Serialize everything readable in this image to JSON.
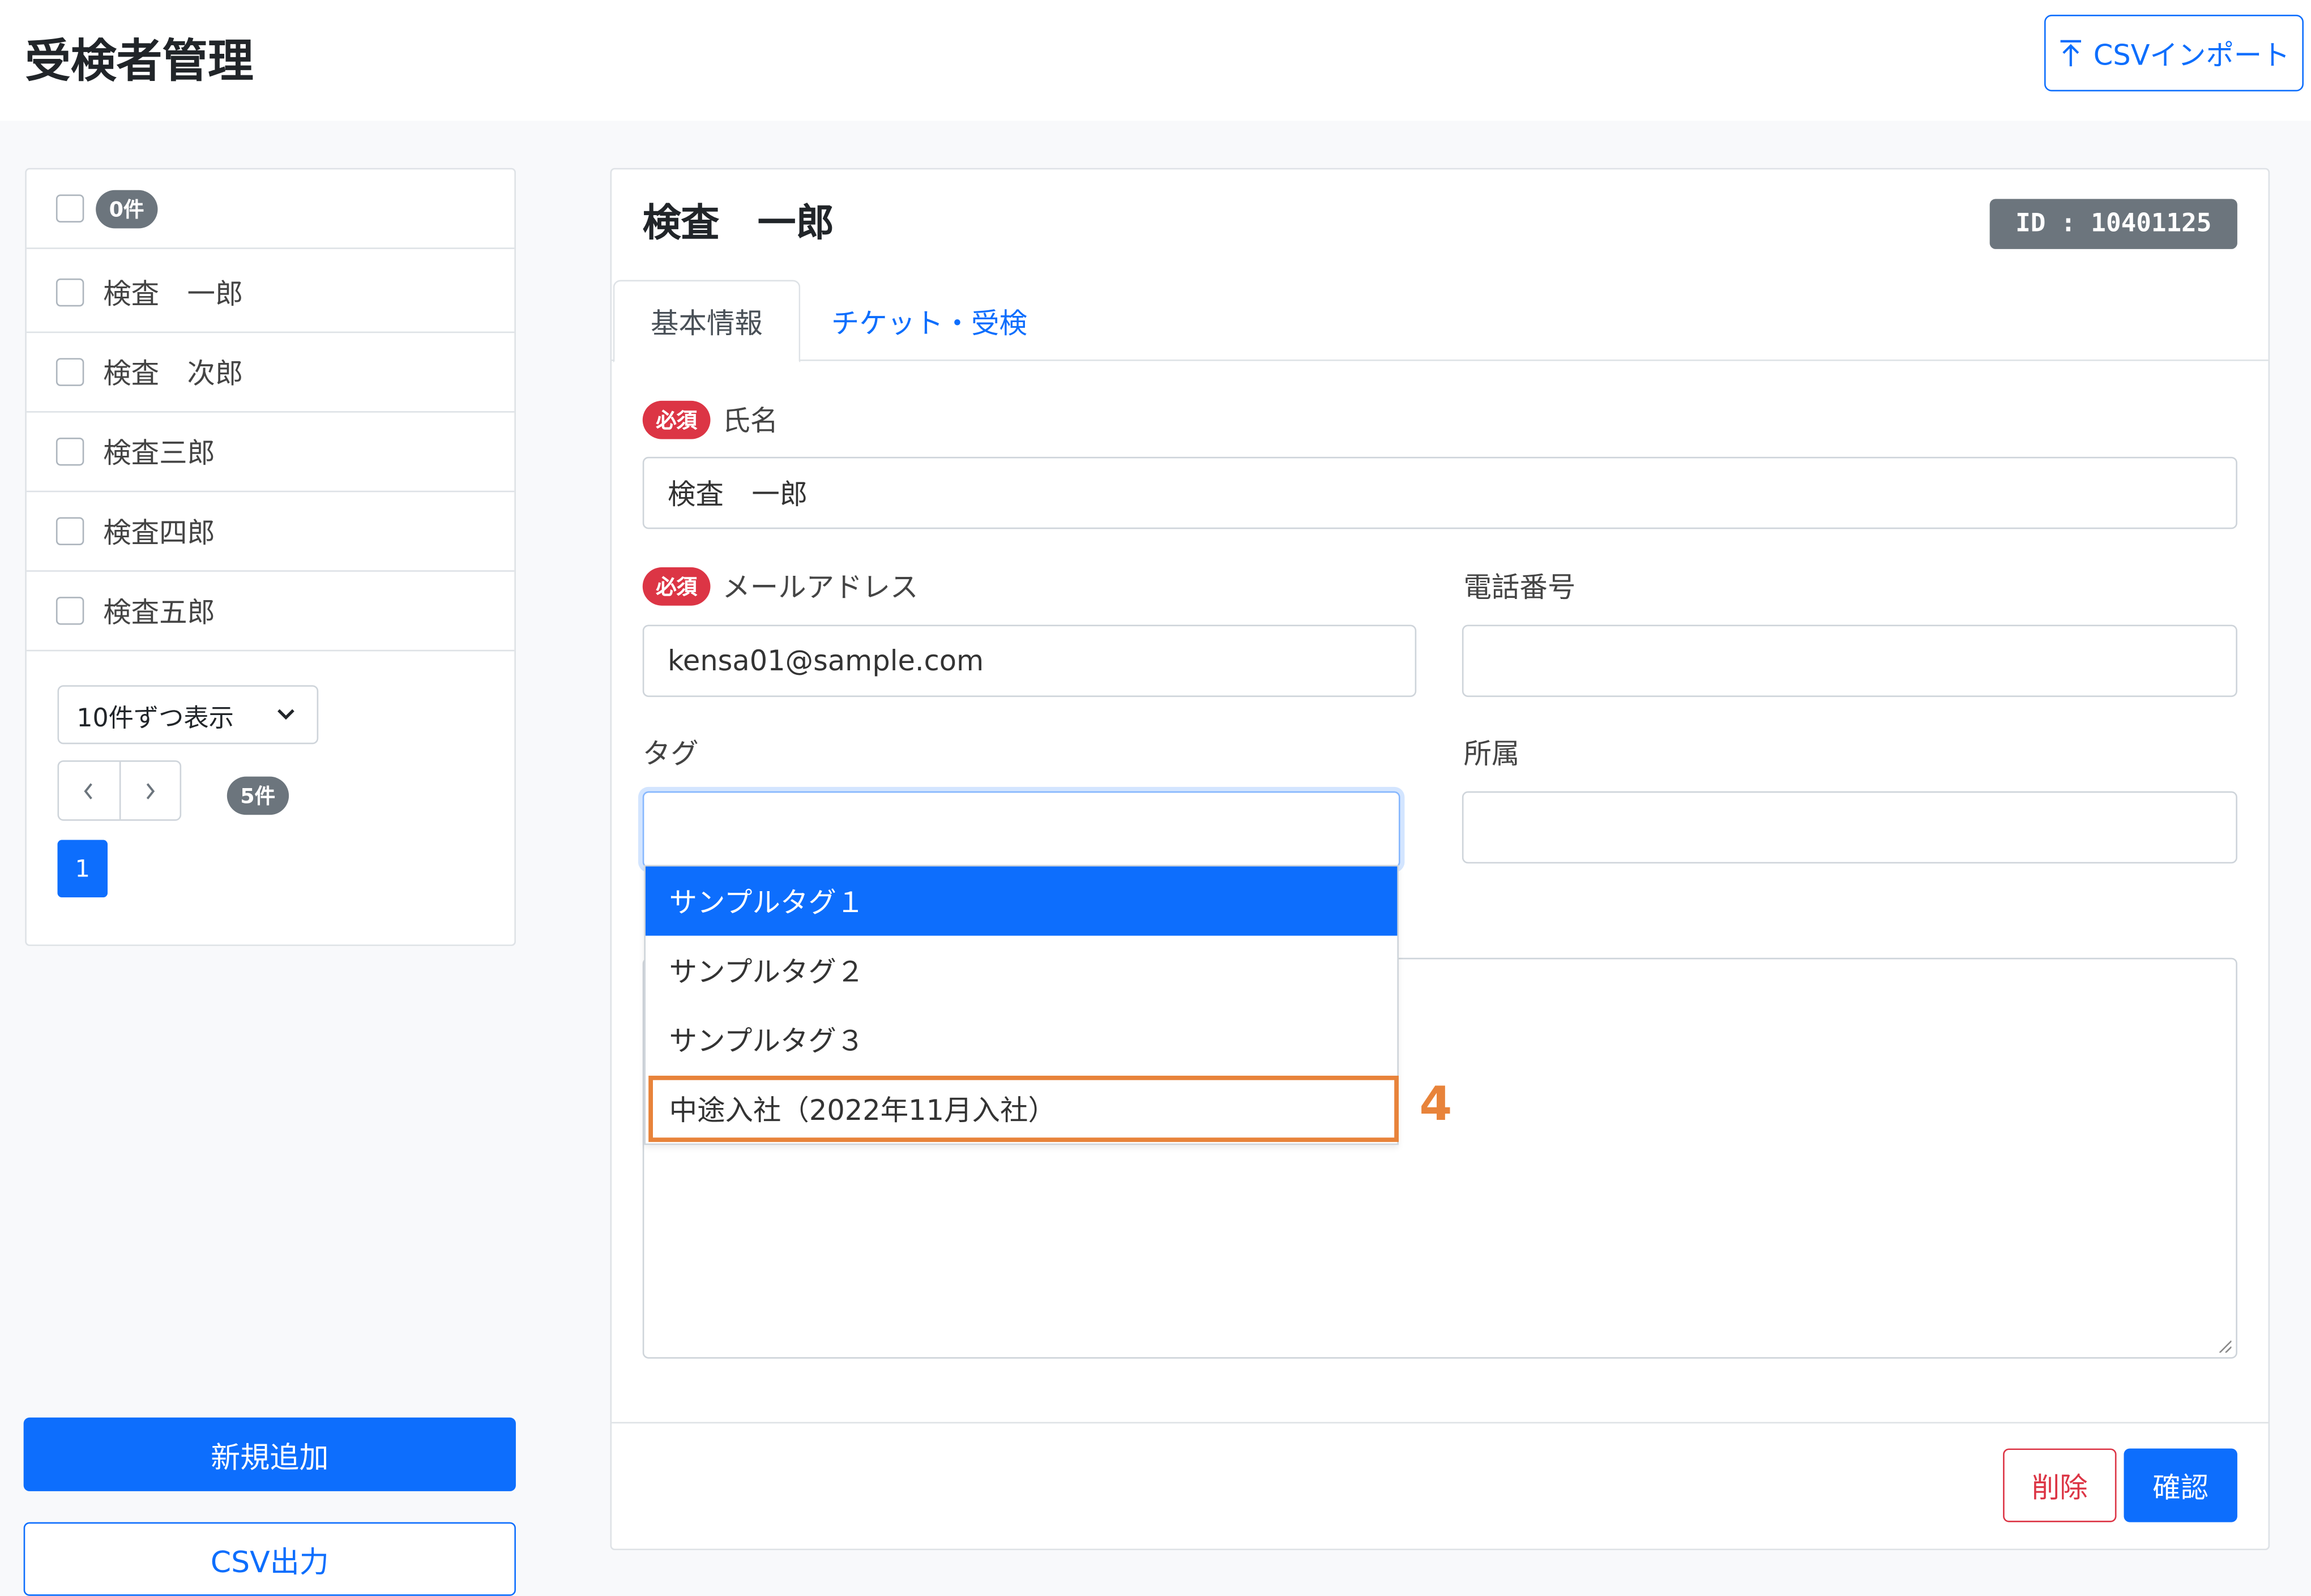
{
  "header": {
    "title": "受検者管理",
    "import_label": "CSVインポート",
    "import_icon": "upload-arrow-icon"
  },
  "examinee_list": {
    "selected_count": "0件",
    "items": [
      {
        "name": "検査　一郎"
      },
      {
        "name": "検査　次郎"
      },
      {
        "name": "検査三郎"
      },
      {
        "name": "検査四郎"
      },
      {
        "name": "検査五郎"
      }
    ],
    "per_page": "10件ずつ表示",
    "total_count": "5件",
    "current_page": "1",
    "add_label": "新規追加",
    "csv_export_label": "CSV出力"
  },
  "detail": {
    "name_heading": "検査　一郎",
    "id_badge": "ID : 10401125",
    "tabs": [
      {
        "label": "基本情報",
        "active": true
      },
      {
        "label": "チケット・受検",
        "active": false
      }
    ],
    "required_badge": "必須",
    "fields": {
      "name": {
        "label": "氏名",
        "value": "検査　一郎"
      },
      "email": {
        "label": "メールアドレス",
        "value": "kensa01@sample.com"
      },
      "phone": {
        "label": "電話番号",
        "value": ""
      },
      "tag": {
        "label": "タグ",
        "value": ""
      },
      "affiliation": {
        "label": "所属",
        "value": ""
      }
    },
    "tag_options": [
      {
        "label": "サンプルタグ１",
        "selected": true
      },
      {
        "label": "サンプルタグ２",
        "selected": false
      },
      {
        "label": "サンプルタグ３",
        "selected": false
      },
      {
        "label": "中途入社（2022年11月入社）",
        "selected": false
      }
    ],
    "annotation_number": "4",
    "delete_label": "削除",
    "confirm_label": "確認"
  },
  "colors": {
    "primary": "#0d6efd",
    "danger": "#dc3545",
    "secondary": "#6c757d",
    "annotation": "#e8833a"
  }
}
